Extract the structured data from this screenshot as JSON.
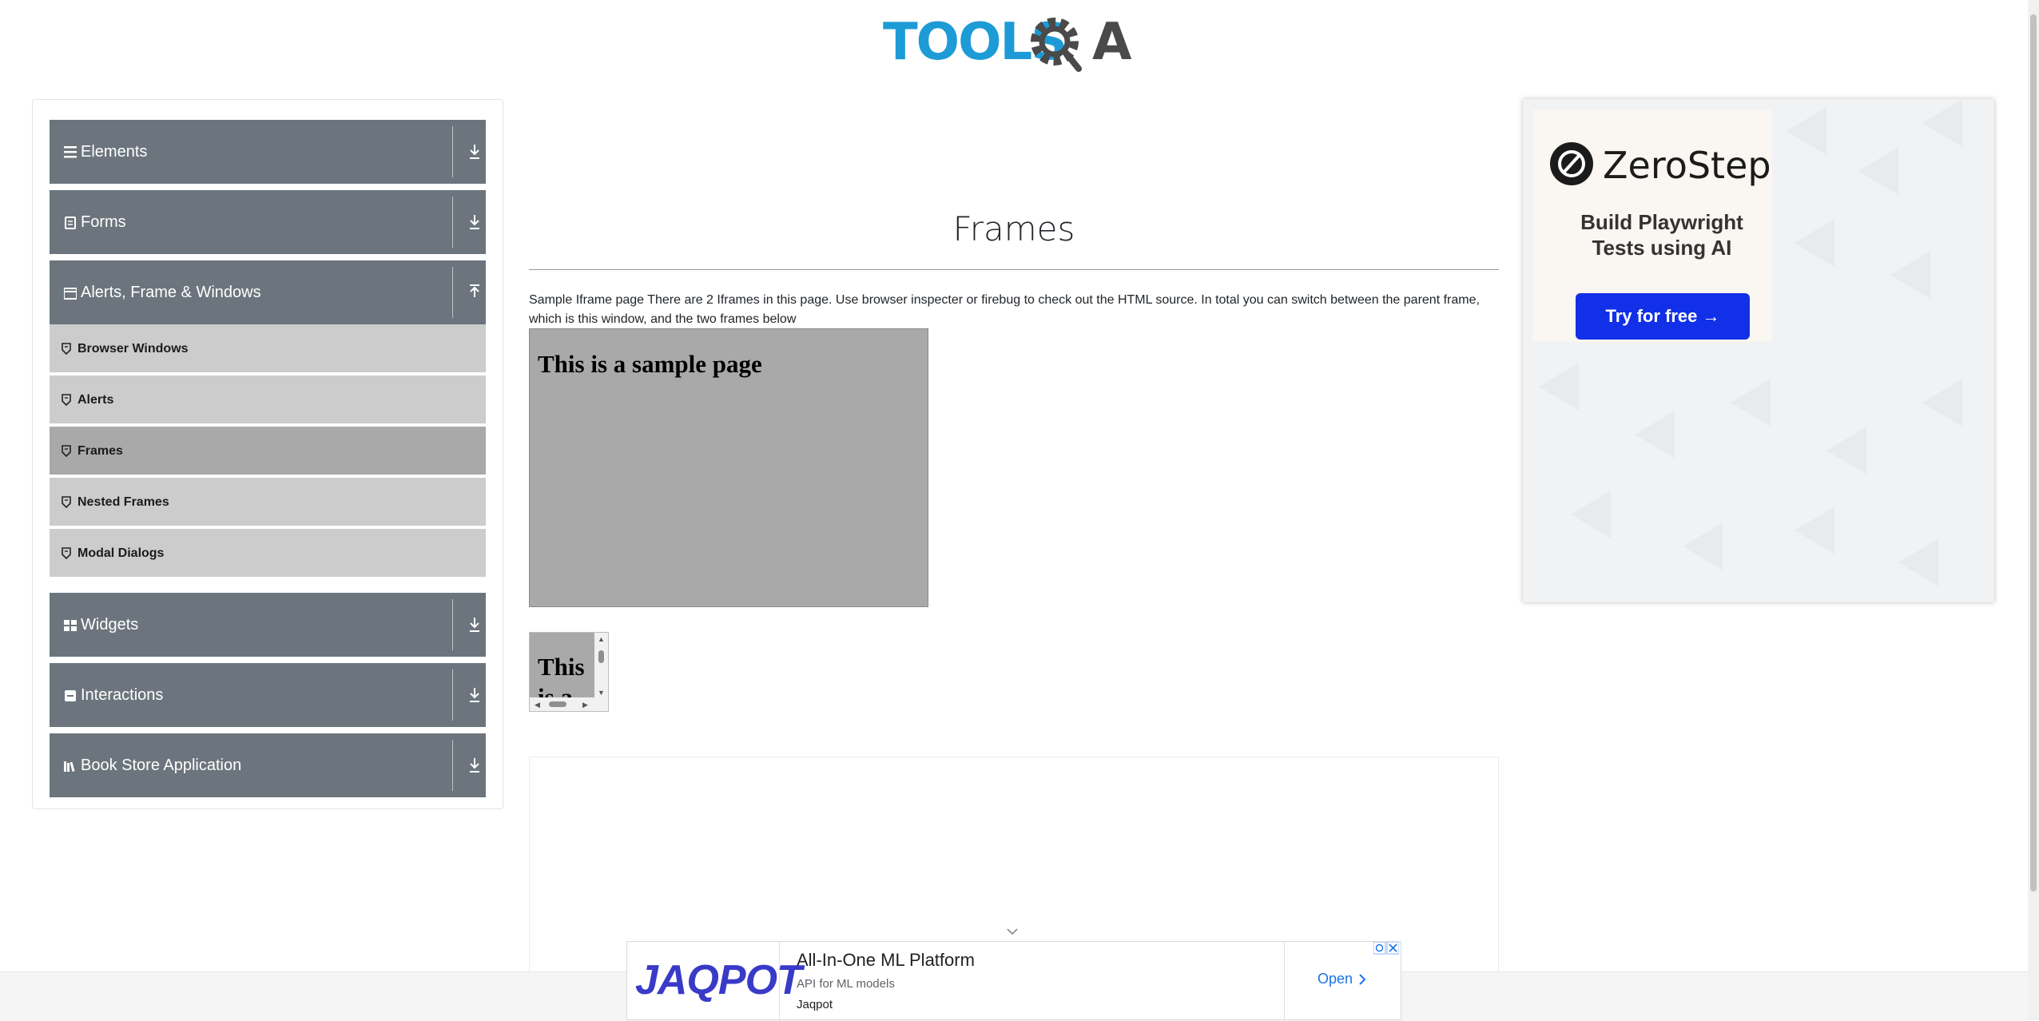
{
  "logo": {
    "text_left": "TOOLS",
    "text_right": "A"
  },
  "sidebar": {
    "groups": [
      {
        "label": "Elements",
        "icon": "list-icon",
        "expanded": false
      },
      {
        "label": "Forms",
        "icon": "form-icon",
        "expanded": false
      },
      {
        "label": "Alerts, Frame & Windows",
        "icon": "window-icon",
        "expanded": true
      },
      {
        "label": "Widgets",
        "icon": "grid-icon",
        "expanded": false
      },
      {
        "label": "Interactions",
        "icon": "interactions-icon",
        "expanded": false
      },
      {
        "label": "Book Store Application",
        "icon": "books-icon",
        "expanded": false
      }
    ],
    "items": [
      {
        "label": "Browser Windows",
        "active": false
      },
      {
        "label": "Alerts",
        "active": false
      },
      {
        "label": "Frames",
        "active": true
      },
      {
        "label": "Nested Frames",
        "active": false
      },
      {
        "label": "Modal Dialogs",
        "active": false
      }
    ]
  },
  "main": {
    "title": "Frames",
    "description": "Sample Iframe page There are 2 Iframes in this page. Use browser inspecter or firebug to check out the HTML source. In total you can switch between the parent frame, which is this window, and the two frames below",
    "frame1_heading": "This is a sample page",
    "frame2_heading": "This is a"
  },
  "right_ad": {
    "brand": "ZeroStep",
    "tagline_line1": "Build Playwright",
    "tagline_line2": "Tests using AI",
    "button": "Try for free →"
  },
  "banner_ad": {
    "logo": "JAQPOT",
    "title": "All-In-One ML Platform",
    "subtitle": "API for ML models",
    "brand": "Jaqpot",
    "cta": "Open"
  },
  "colors": {
    "sidebar_header": "#6c757d",
    "menu_item": "#cccccc",
    "menu_item_active": "#a9a9a9",
    "logo_blue": "#1d9bd6",
    "logo_dark": "#4a4a4a",
    "cta_blue": "#1130e8"
  }
}
